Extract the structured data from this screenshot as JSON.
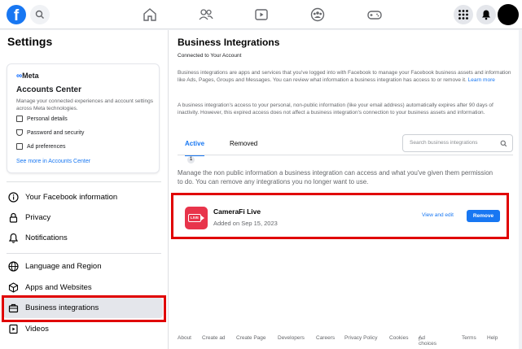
{
  "topbar": {
    "logo_letter": "f",
    "icons": [
      "home-icon",
      "friends-icon",
      "watch-icon",
      "groups-icon",
      "gaming-icon",
      "menu-grid-icon",
      "notifications-bell-icon"
    ]
  },
  "sidebar": {
    "title": "Settings",
    "accounts_center": {
      "brand": "Meta",
      "title": "Accounts Center",
      "description": "Manage your connected experiences and account settings across Meta technologies.",
      "items": [
        "Personal details",
        "Password and security",
        "Ad preferences"
      ],
      "link": "See more in Accounts Center"
    },
    "nav_items": [
      {
        "label": "Your Facebook information",
        "icon": "info-icon"
      },
      {
        "label": "Privacy",
        "icon": "lock-icon"
      },
      {
        "label": "Notifications",
        "icon": "bell-icon"
      },
      {
        "label": "Language and Region",
        "icon": "globe-icon"
      },
      {
        "label": "Apps and Websites",
        "icon": "cube-icon"
      },
      {
        "label": "Business integrations",
        "icon": "briefcase-icon",
        "active": true
      },
      {
        "label": "Videos",
        "icon": "video-icon"
      }
    ]
  },
  "main": {
    "title": "Business Integrations",
    "subtitle": "Connected to Your Account",
    "para1": "Business integrations are apps and services that you've logged into with Facebook to manage your Facebook business assets and information like Ads, Pages, Groups and Messages. You can review what information a business integration has access to or remove it.",
    "para1_link": "Learn more",
    "para2": "A business integration's access to your personal, non-public information (like your email address) automatically expires after 90 days of inactivity. However, this expired access does not affect a business integration's connection to your business assets and information.",
    "tabs": {
      "active_label": "Active",
      "active_count": "1",
      "removed_label": "Removed"
    },
    "search_placeholder": "Search business integrations",
    "manage_text": "Manage the non public information a business integration can access and what you've given them permission to do. You can remove any integrations you no longer want to use.",
    "integration": {
      "logo_text": "LIVE",
      "name": "CameraFi Live",
      "added": "Added on Sep 15, 2023",
      "view_edit": "View and edit",
      "remove": "Remove"
    },
    "footer": [
      "About",
      "Create ad",
      "Create Page",
      "Developers",
      "Careers",
      "Privacy Policy",
      "Cookies",
      "Ad choices",
      "Terms",
      "Help"
    ]
  },
  "colors": {
    "brand_blue": "#1877f2",
    "highlight_red": "#e00000",
    "app_logo_red": "#e8344b"
  }
}
